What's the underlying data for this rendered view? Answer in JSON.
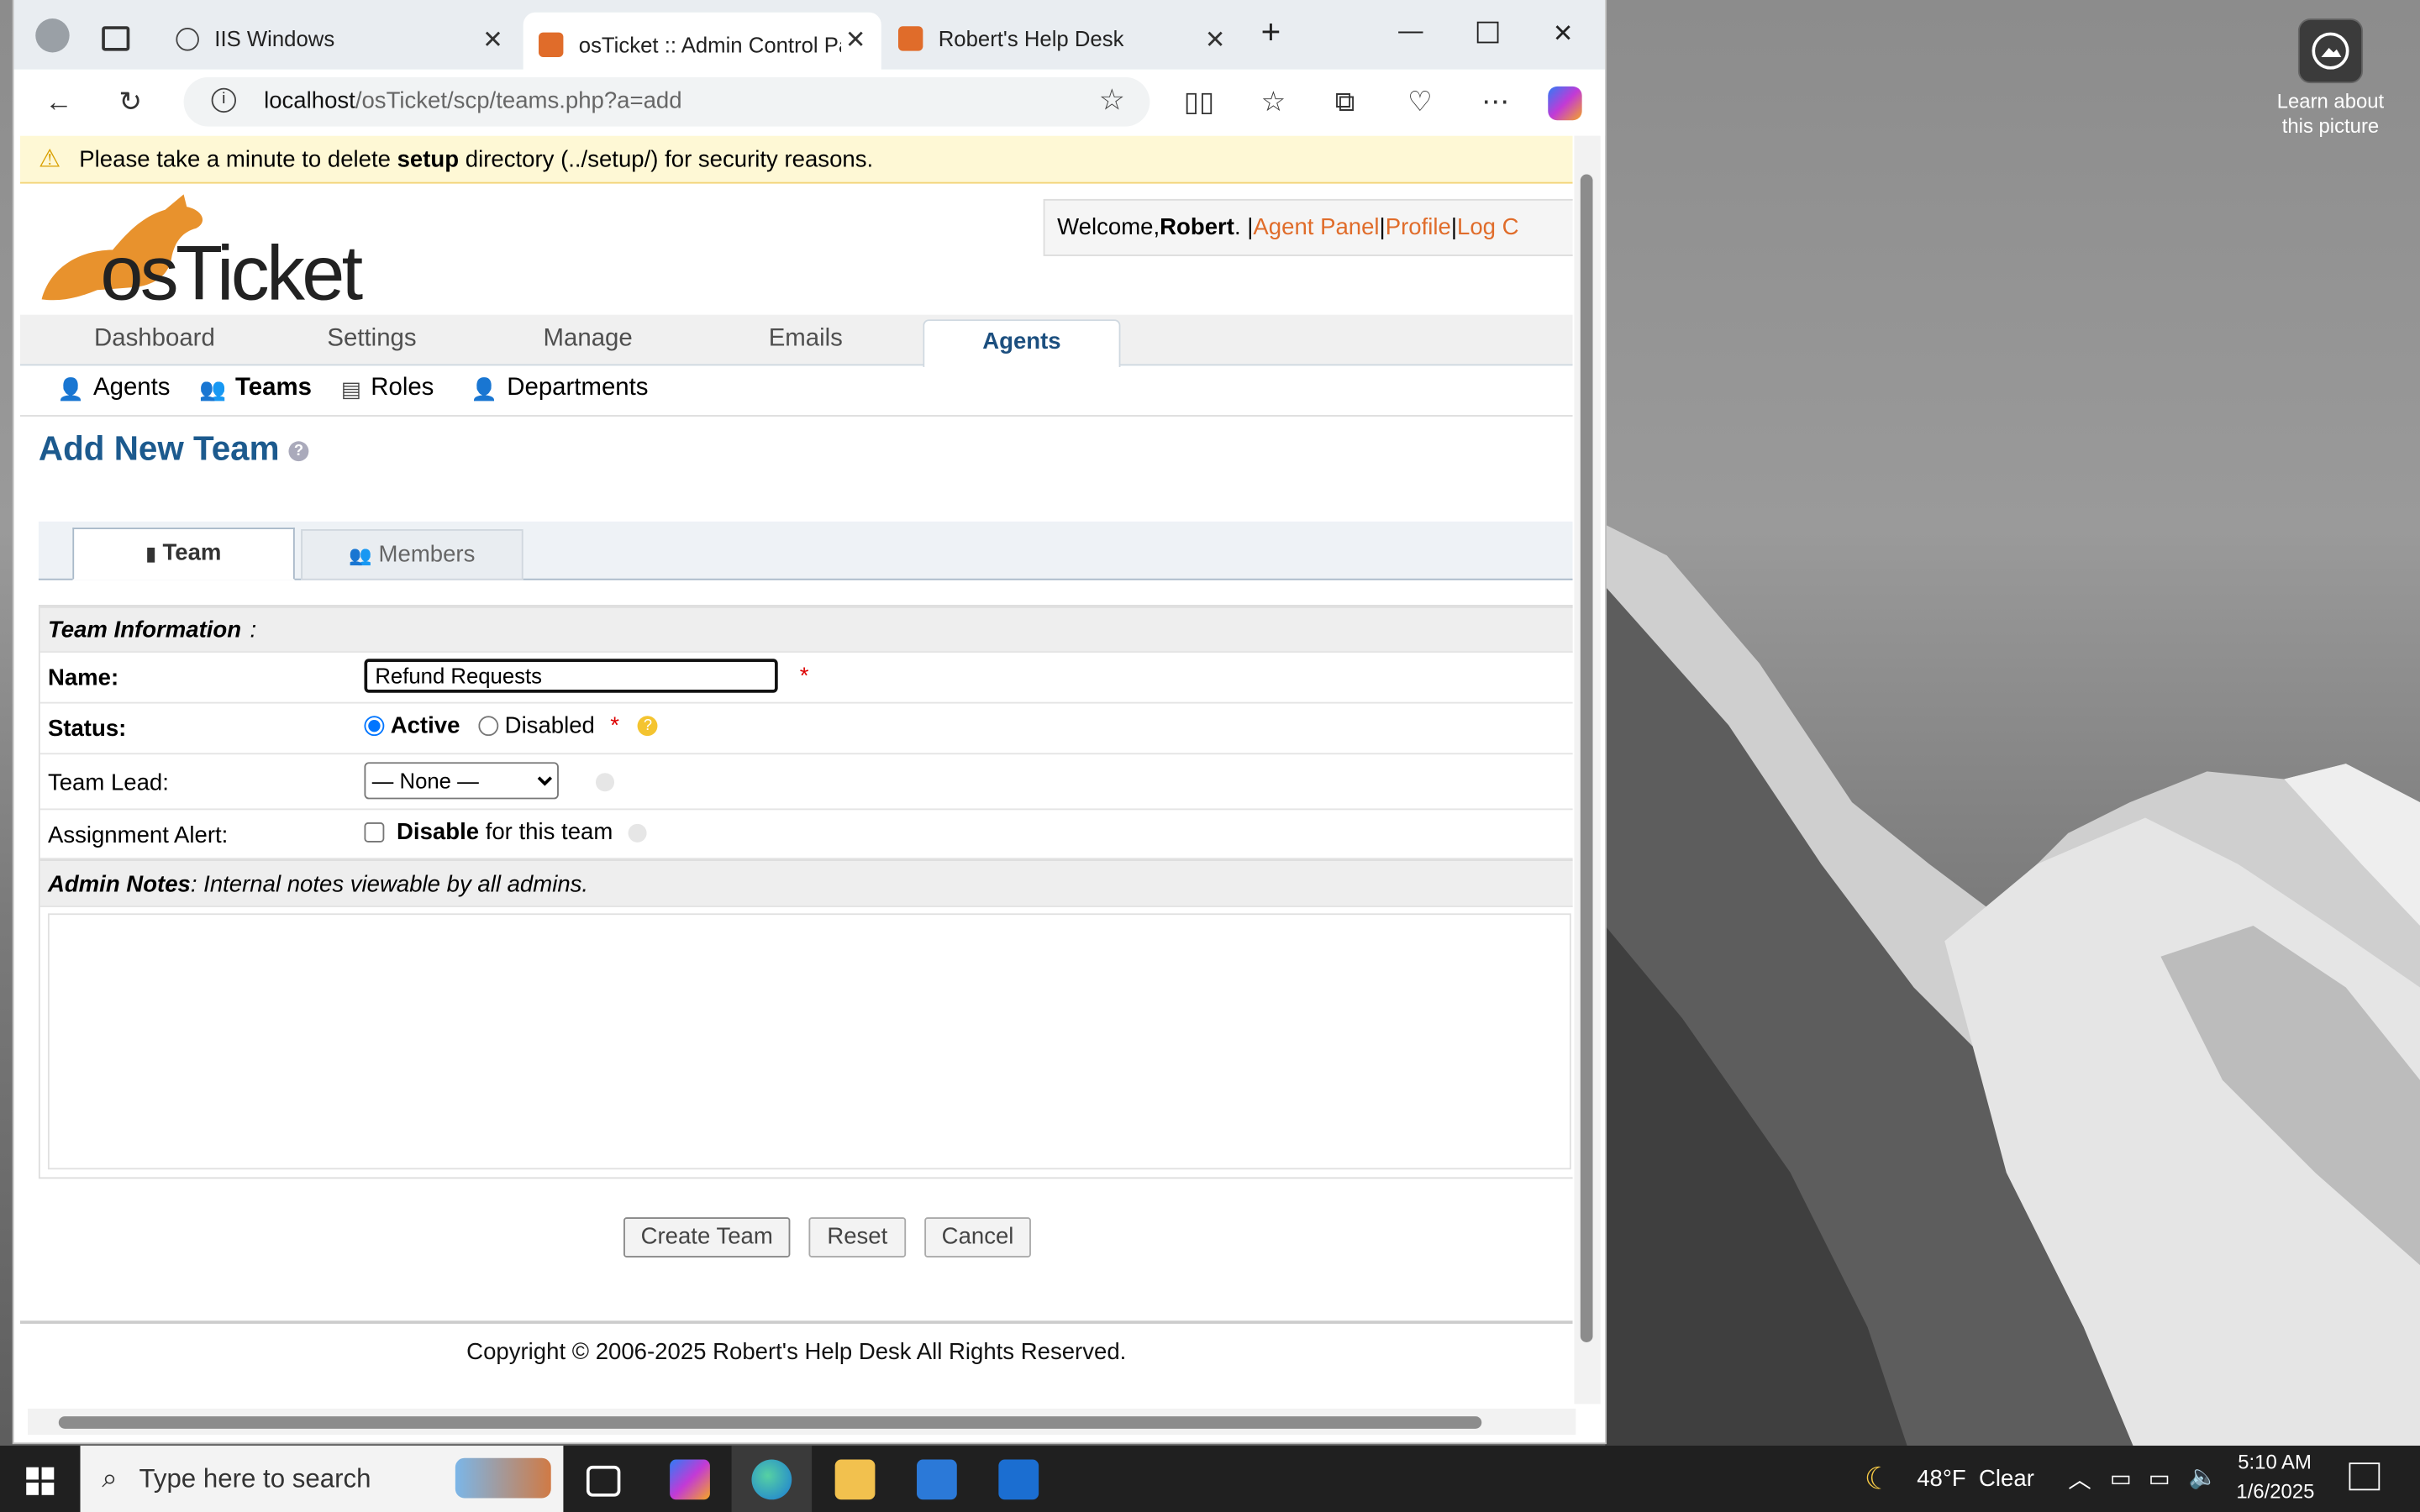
{
  "desktop": {
    "learn_line1": "Learn about",
    "learn_line2": "this picture"
  },
  "browser": {
    "tabs": [
      {
        "title": "IIS Windows"
      },
      {
        "title": "osTicket :: Admin Control Par"
      },
      {
        "title": "Robert's Help Desk"
      }
    ],
    "url_host": "localhost",
    "url_path": "/osTicket/scp/teams.php?a=add"
  },
  "banner": {
    "prefix": "Please take a minute to delete ",
    "bold": "setup",
    "suffix": " directory (../setup/) for security reasons."
  },
  "header": {
    "logo_text": "osTicket",
    "welcome_prefix": "Welcome, ",
    "user": "Robert",
    "sep1": ". | ",
    "agent_panel": "Agent Panel",
    "sep2": " | ",
    "profile": "Profile",
    "sep3": " | ",
    "logout": "Log C"
  },
  "nav": {
    "items": [
      "Dashboard",
      "Settings",
      "Manage",
      "Emails",
      "Agents"
    ],
    "active": "Agents"
  },
  "subnav": {
    "items": [
      "Agents",
      "Teams",
      "Roles",
      "Departments"
    ],
    "active": "Teams"
  },
  "page": {
    "title": "Add New Team",
    "tabs": [
      "Team",
      "Members"
    ]
  },
  "form": {
    "section_info": "Team Information",
    "name_label": "Name:",
    "name_value": "Refund Requests",
    "status_label": "Status:",
    "status_active": "Active",
    "status_disabled": "Disabled",
    "status_selected": "Active",
    "lead_label": "Team Lead:",
    "lead_value": "— None —",
    "alert_label": "Assignment Alert:",
    "alert_bold": "Disable",
    "alert_suffix": " for this team",
    "alert_checked": false,
    "notes_title": "Admin Notes",
    "notes_desc": ": Internal notes viewable by all admins.",
    "notes_value": ""
  },
  "buttons": {
    "create": "Create Team",
    "reset": "Reset",
    "cancel": "Cancel"
  },
  "footer": {
    "copyright": "Copyright © 2006-2025 Robert's Help Desk All Rights Reserved."
  },
  "taskbar": {
    "search_placeholder": "Type here to search",
    "weather": "48°F  Clear",
    "time": "5:10 AM",
    "date": "1/6/2025"
  },
  "colors": {
    "accent": "#e06c2a",
    "title_blue": "#1c5a8e",
    "banner": "#fef8d5"
  }
}
